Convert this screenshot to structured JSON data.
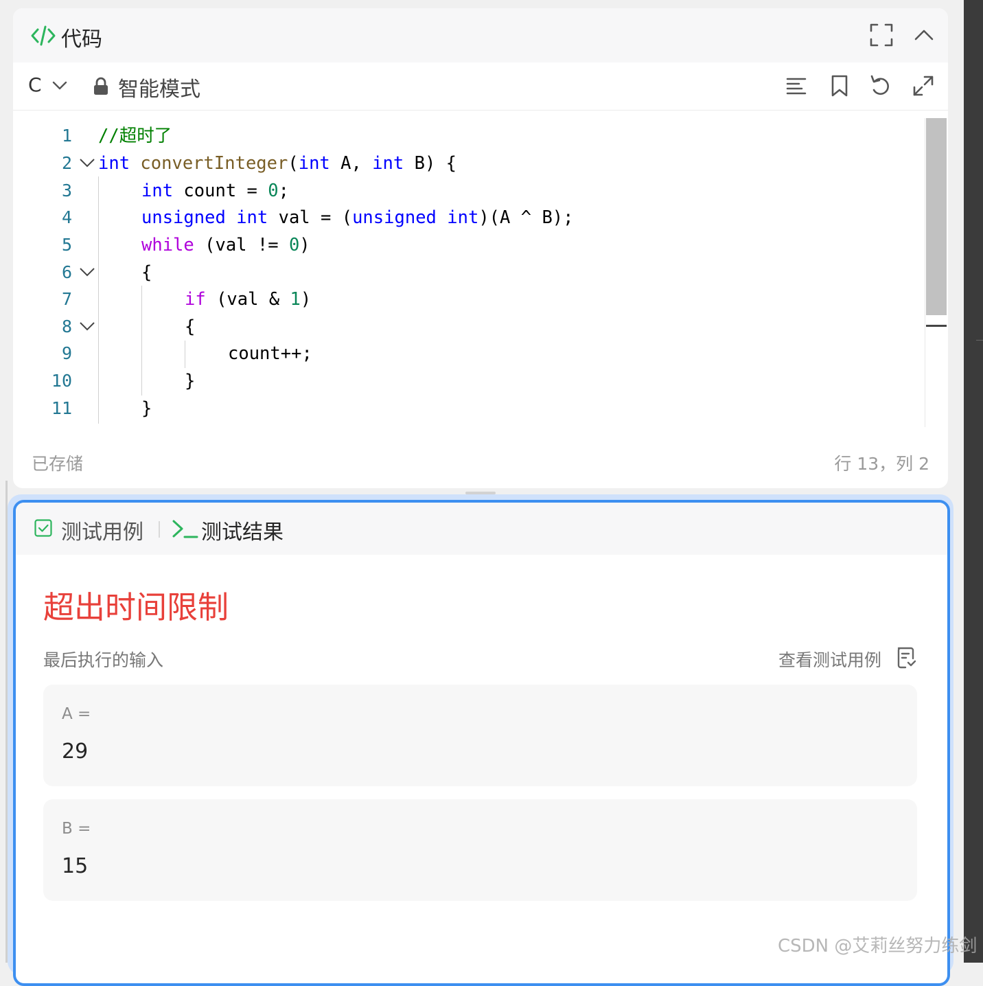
{
  "code_panel": {
    "title": "代码",
    "language": "C",
    "mode_label": "智能模式",
    "lines": [
      {
        "num": "1"
      },
      {
        "num": "2"
      },
      {
        "num": "3"
      },
      {
        "num": "4"
      },
      {
        "num": "5"
      },
      {
        "num": "6"
      },
      {
        "num": "7"
      },
      {
        "num": "8"
      },
      {
        "num": "9"
      },
      {
        "num": "10"
      },
      {
        "num": "11"
      }
    ],
    "code": {
      "l1_comment": "//超时了",
      "l2_int": "int",
      "l2_fn": "convertInteger",
      "l2_p1": "(",
      "l2_int2": "int",
      "l2_p2": " A, ",
      "l2_int3": "int",
      "l2_p3": " B) {",
      "l3_int": "int",
      "l3_p1": " count = ",
      "l3_num": "0",
      "l3_p2": ";",
      "l4_unsigned": "unsigned",
      "l4_int": "int",
      "l4_p1": " val = (",
      "l4_unsigned2": "unsigned",
      "l4_int2": "int",
      "l4_p2": ")(A ^ B);",
      "l5_while": "while",
      "l5_p1": " (val != ",
      "l5_num": "0",
      "l5_p2": ")",
      "l6_brace": "{",
      "l7_if": "if",
      "l7_p1": " (val & ",
      "l7_num": "1",
      "l7_p2": ")",
      "l8_brace": "{",
      "l9_text": "count++;",
      "l10_brace": "}",
      "l11_brace": "}"
    },
    "status_saved": "已存储",
    "cursor_position": "行 13，列 2"
  },
  "result_panel": {
    "tab_cases": "测试用例",
    "tab_result": "测试结果",
    "verdict": "超出时间限制",
    "last_input_label": "最后执行的输入",
    "view_cases_label": "查看测试用例",
    "inputs": [
      {
        "name": "A =",
        "value": "29"
      },
      {
        "name": "B =",
        "value": "15"
      }
    ]
  },
  "watermark": "CSDN @艾莉丝努力练剑",
  "colors": {
    "accent_green": "#2db55d",
    "verdict_red": "#e8403a",
    "focus_blue": "#3d8ff0",
    "keyword_blue": "#0000ff",
    "control_purple": "#af00db",
    "function_brown": "#795e26",
    "number_green": "#098658",
    "comment_green": "#008000",
    "line_number": "#237893"
  },
  "icons": [
    "code-icon",
    "fullscreen-icon",
    "chevron-up-icon",
    "chevron-down-icon",
    "lock-icon",
    "format-icon",
    "bookmark-icon",
    "undo-icon",
    "expand-icon",
    "checkbox-icon",
    "terminal-icon",
    "document-icon",
    "fold-chevron-icon"
  ]
}
